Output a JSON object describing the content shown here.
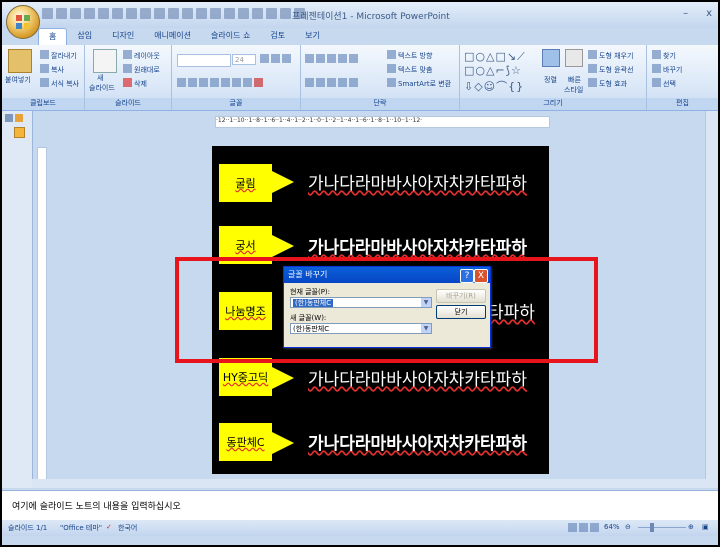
{
  "window": {
    "title": "프레젠테이션1 - Microsoft PowerPoint",
    "minimize": "–",
    "close": "x"
  },
  "tabs": [
    "홈",
    "삽입",
    "디자인",
    "애니메이션",
    "슬라이드 쇼",
    "검토",
    "보기"
  ],
  "ribbon": {
    "clipboard": {
      "paste": "붙여넣기",
      "cut": "잘라내기",
      "copy": "복사",
      "format_painter": "서식 복사",
      "label": "클립보드"
    },
    "slides": {
      "new_slide_1": "새",
      "new_slide_2": "슬라이드",
      "layout": "레이아웃",
      "reset": "원래대로",
      "delete": "삭제",
      "label": "슬라이드"
    },
    "font": {
      "size": "24",
      "label": "글꼴"
    },
    "paragraph": {
      "text_direction": "텍스트 방향",
      "align_text": "텍스트 맞춤",
      "smartart": "SmartArt로 변환",
      "label": "단락"
    },
    "drawing": {
      "arrange": "정렬",
      "quick_styles_1": "빠른",
      "quick_styles_2": "스타일",
      "shape_fill": "도형 채우기",
      "shape_outline": "도형 윤곽선",
      "shape_effects": "도형 효과",
      "label": "그리기"
    },
    "editing": {
      "find": "찾기",
      "replace": "바꾸기",
      "select": "선택",
      "label": "편집"
    }
  },
  "ruler": "·12··1··10··1··8··1··6··1··4··1··2··1··0··1··2··1··4··1··6··1··8··1··10··1··12·",
  "slide": {
    "rows": [
      {
        "font": "굴림",
        "sample": "가나다라마바사아자차카타파하"
      },
      {
        "font": "궁서",
        "sample": "가나다라마바사아자차카타파하"
      },
      {
        "font": "나눔명조",
        "sample": "가나다라마바사아자차카타파하"
      },
      {
        "font": "HY중고딕",
        "sample": "가나다라마바사아자차카타파하"
      },
      {
        "font": "동판체C",
        "sample": "가나다라마바사아자차카타파하"
      }
    ],
    "partial_sample": "타파하"
  },
  "dialog": {
    "title": "글꼴 바꾸기",
    "help": "?",
    "close": "X",
    "current_font_label": "현재 글꼴(P):",
    "current_font_value": "(한)동판체C",
    "new_font_label": "새 글꼴(W):",
    "new_font_value": "(한)동판체C",
    "replace_button": "바꾸기(R)",
    "close_button": "닫기"
  },
  "notes": {
    "placeholder": "여기에 슬라이드 노트의 내용을 입력하십시오"
  },
  "status": {
    "slide_info": "슬라이드 1/1",
    "theme": "\"Office 테마\"",
    "language": "한국어",
    "zoom": "64%"
  },
  "colors": {
    "highlight": "#e8141c",
    "label_fill": "#ffff00",
    "slide_bg": "#000000"
  }
}
